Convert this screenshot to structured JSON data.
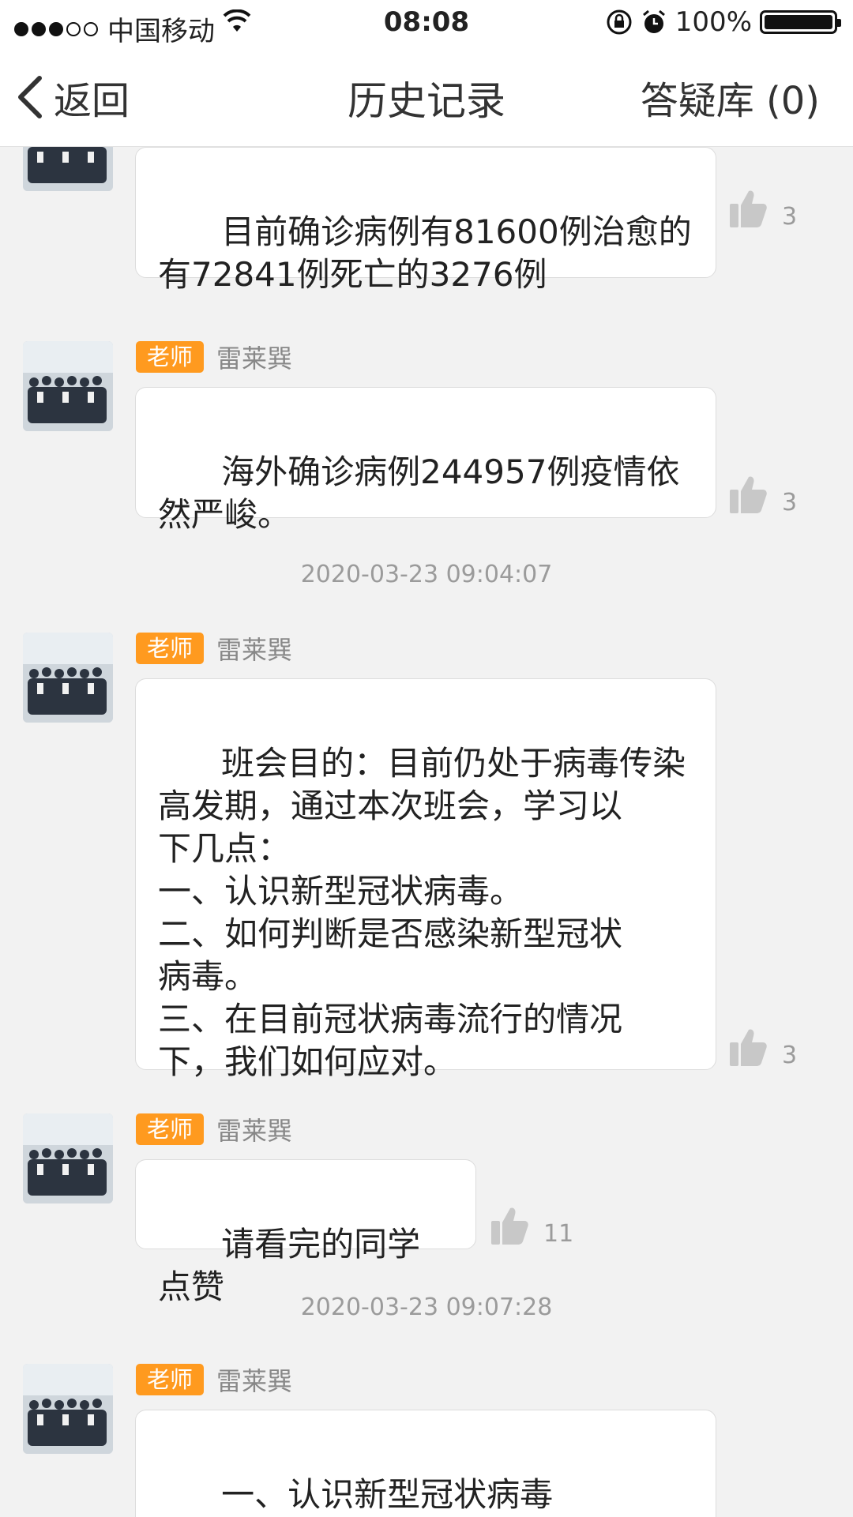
{
  "status_bar": {
    "carrier": "中国移动",
    "time": "08:08",
    "battery": "100%",
    "icons": [
      "signal-icon",
      "wifi-icon",
      "rotation-lock-icon",
      "alarm-icon",
      "battery-icon"
    ]
  },
  "nav": {
    "back_label": "返回",
    "title": "历史记录",
    "qa_label": "答疑库 (0)"
  },
  "colors": {
    "badge": "#ff9a1f",
    "background": "#f2f2f2",
    "bubble": "#ffffff"
  },
  "messages": [
    {
      "role": "",
      "sender": "",
      "text": "目前确诊病例有81600例治愈的\n有72841例死亡的3276例",
      "likes": "3"
    },
    {
      "role": "老师",
      "sender": "雷莱巽",
      "text": "海外确诊病例244957例疫情依\n然严峻。",
      "likes": "3"
    },
    {
      "role": "老师",
      "sender": "雷莱巽",
      "text": "班会目的：目前仍处于病毒传染\n高发期，通过本次班会，学习以\n下几点：\n一、认识新型冠状病毒。\n二、如何判断是否感染新型冠状\n病毒。\n三、在目前冠状病毒流行的情况\n下，我们如何应对。",
      "likes": "3"
    },
    {
      "role": "老师",
      "sender": "雷莱巽",
      "text": "请看完的同学点赞",
      "likes": "11"
    },
    {
      "role": "老师",
      "sender": "雷莱巽",
      "text": "一、认识新型冠状病毒\n冠状病毒是一类主要引起呼吸",
      "likes": ""
    }
  ],
  "timestamps": [
    "2020-03-23 09:04:07",
    "2020-03-23 09:07:28"
  ]
}
